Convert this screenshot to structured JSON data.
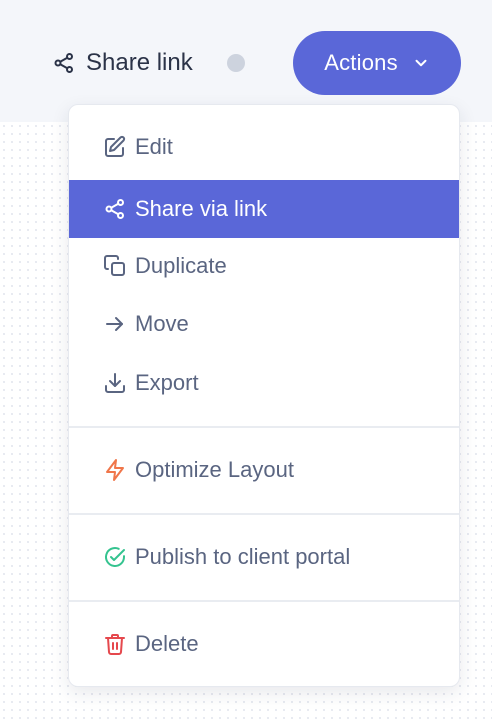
{
  "header": {
    "share_link_label": "Share link",
    "actions_label": "Actions"
  },
  "menu": {
    "items": [
      {
        "label": "Edit",
        "icon": "edit-icon"
      },
      {
        "label": "Share via link",
        "icon": "share-icon",
        "active": true
      },
      {
        "label": "Duplicate",
        "icon": "duplicate-icon"
      },
      {
        "label": "Move",
        "icon": "arrow-right-icon"
      },
      {
        "label": "Export",
        "icon": "download-icon"
      },
      {
        "label": "Optimize Layout",
        "icon": "lightning-icon"
      },
      {
        "label": "Publish to client portal",
        "icon": "check-circle-icon"
      },
      {
        "label": "Delete",
        "icon": "trash-icon"
      }
    ]
  },
  "colors": {
    "accent": "#5a67d8",
    "menu_text": "#5a6581",
    "optimize_icon": "#f0764a",
    "publish_icon": "#34c38f",
    "delete_icon": "#e5484d"
  }
}
